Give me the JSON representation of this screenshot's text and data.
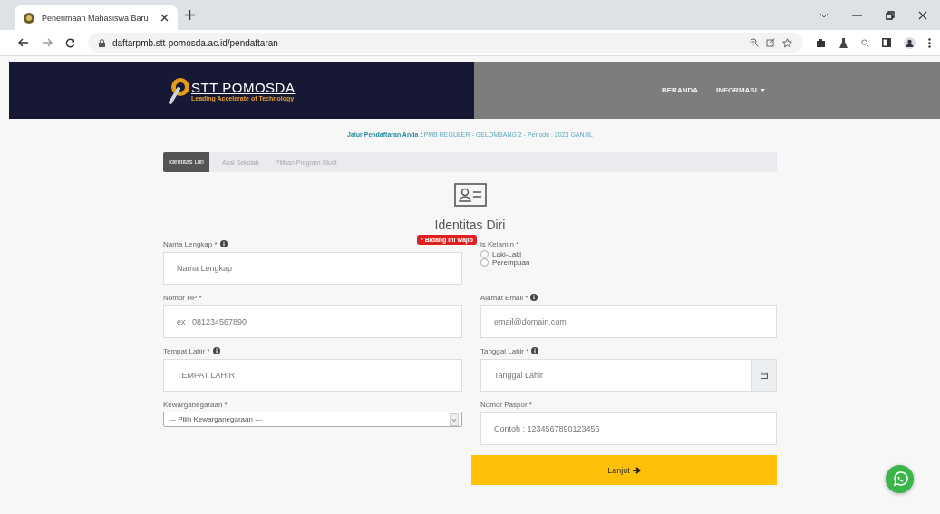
{
  "browser": {
    "tab_title": "Penerimaan Mahasiswa Baru",
    "url": "daftarpmb.stt-pomosda.ac.id/pendaftaran"
  },
  "header": {
    "logo_title": "STT POMOSDA",
    "logo_tagline": "Leading Accelerate of Technology",
    "nav": [
      {
        "label": "BERANDA",
        "kind": "link"
      },
      {
        "label": "INFORMASI",
        "kind": "dropdown"
      }
    ]
  },
  "registration_path": {
    "label": "Jalur Pendaftaran Anda :",
    "value": "PMB REGULER - GELOMBANG 2 - Periode : 2023 GANJIL"
  },
  "steps": [
    {
      "label": "Identitas Diri",
      "selected": true
    },
    {
      "label": "Asal Sekolah",
      "selected": false
    },
    {
      "label": "Pilihan Program Studi",
      "selected": false
    }
  ],
  "section_title": "Identitas Diri",
  "tooltip": "* Bidang ini wajib",
  "fields": [
    {
      "label": "Nama Lengkap *",
      "info": true,
      "kind": "text",
      "placeholder": "Nama Lengkap"
    },
    {
      "label": "is Kelamin *",
      "info": false,
      "kind": "radio",
      "options": [
        {
          "label": "Laki-Laki",
          "selected": false
        },
        {
          "label": "Perempuan",
          "selected": false
        }
      ]
    },
    {
      "label": "Nomor HP *",
      "info": false,
      "kind": "text",
      "placeholder": "ex : 081234567890"
    },
    {
      "label": "Alamat Email *",
      "info": true,
      "kind": "text",
      "placeholder": "email@domain.com"
    },
    {
      "label": "Tempat Lahir *",
      "info": true,
      "kind": "text",
      "placeholder": "TEMPAT LAHIR"
    },
    {
      "label": "Tanggal Lahir *",
      "info": true,
      "kind": "date",
      "placeholder": "Tanggal Lahir"
    },
    {
      "label": "Kewarganegaraan *",
      "info": false,
      "kind": "select",
      "value": "--- Pilih Kewarganegaraan ---"
    },
    {
      "label": "Nomor Paspor *",
      "info": false,
      "kind": "text",
      "placeholder": "Contoh : 1234567890123456"
    }
  ],
  "submit": "Lanjut"
}
